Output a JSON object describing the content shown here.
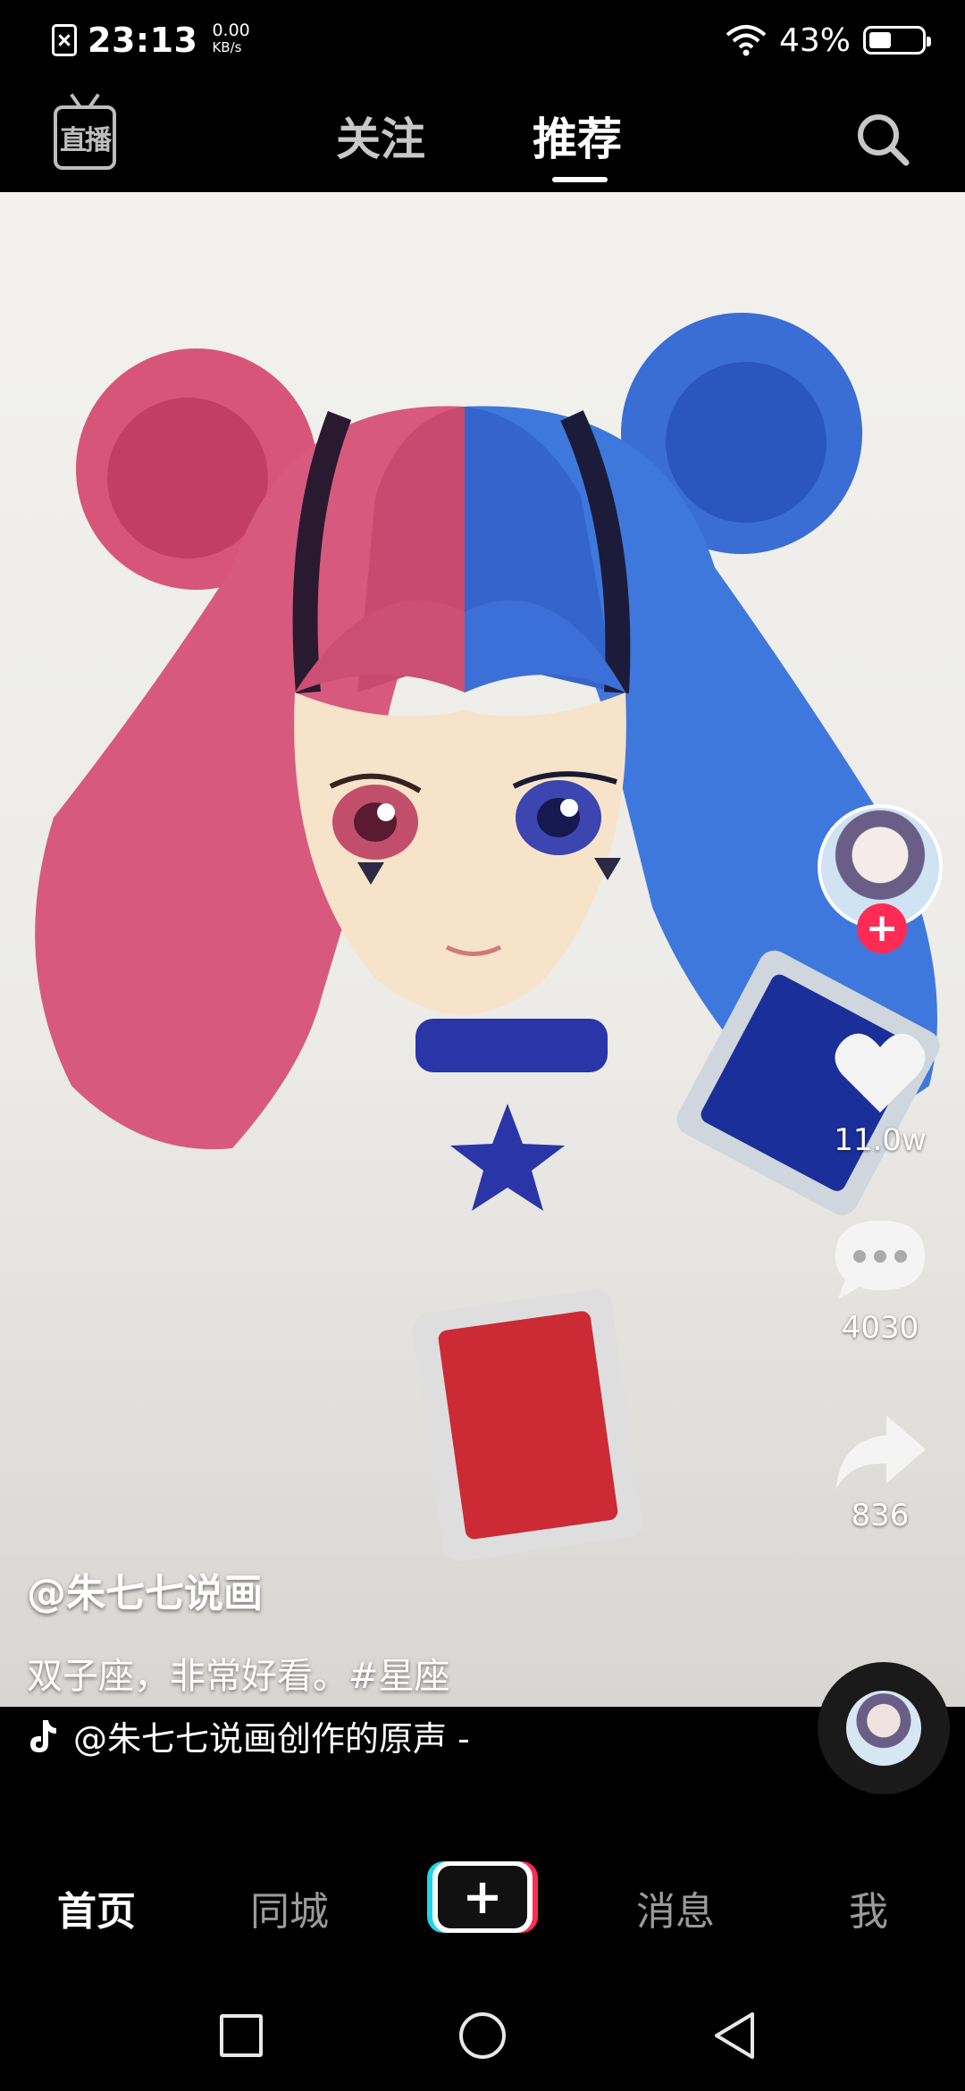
{
  "status_bar": {
    "time": "23:13",
    "net_speed_value": "0.00",
    "net_speed_unit": "KB/s",
    "battery_percent": "43%",
    "battery_level": 0.43
  },
  "top_nav": {
    "live_label": "直播",
    "tabs": [
      {
        "label": "关注",
        "active": false
      },
      {
        "label": "推荐",
        "active": true
      }
    ]
  },
  "video": {
    "author": "@朱七七说画",
    "description": "双子座，非常好看。#星座",
    "music": "@朱七七说画创作的原声 -"
  },
  "actions": {
    "like_count": "11.0w",
    "comment_count": "4030",
    "share_count": "836",
    "follow_symbol": "+"
  },
  "bottom_nav": {
    "items": [
      "首页",
      "同城",
      "消息",
      "我"
    ],
    "create_symbol": "+"
  },
  "icons": {
    "search": "search-icon",
    "like": "heart-icon",
    "comment": "comment-icon",
    "share": "share-icon",
    "music": "tiktok-note-icon"
  },
  "colors": {
    "accent_red": "#fe2c55",
    "accent_cyan": "#20d5ec",
    "background": "#000000"
  }
}
